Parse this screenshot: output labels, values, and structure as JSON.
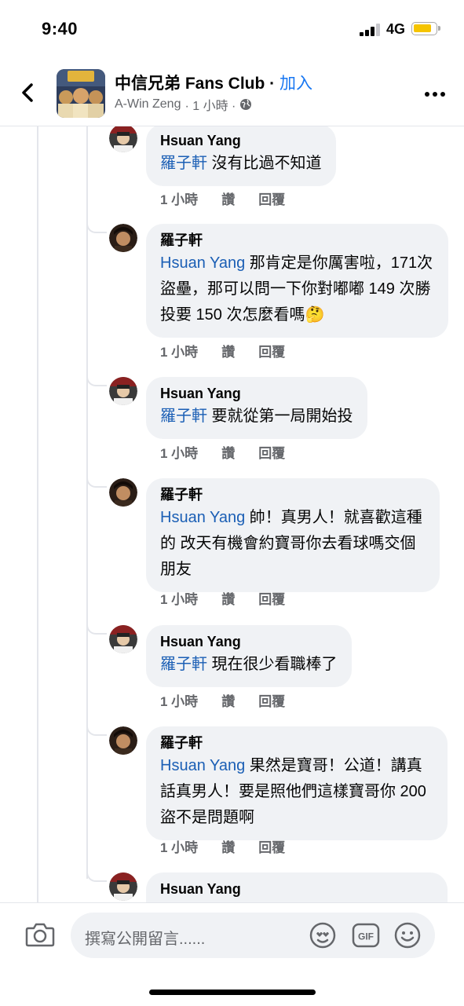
{
  "status_bar": {
    "time": "9:40",
    "network": "4G"
  },
  "header": {
    "group_name": "中信兄弟 Fans Club",
    "separator": " · ",
    "join_label": "加入",
    "post_author": "A-Win Zeng",
    "post_time": " · 1 小時 · "
  },
  "thread": {
    "comments": [
      {
        "author": "Hsuan Yang",
        "mention": "羅子軒",
        "text": " 沒有比過不知道",
        "time": "1 小時",
        "like": "讚",
        "reply": "回覆"
      },
      {
        "author": "羅子軒",
        "mention": "Hsuan Yang",
        "text": " 那肯定是你厲害啦，171次盜壘，那可以問一下你對嘟嘟 149 次勝投要 150 次怎麼看嗎🤔",
        "time": "1 小時",
        "like": "讚",
        "reply": "回覆"
      },
      {
        "author": "Hsuan Yang",
        "mention": "羅子軒",
        "text": " 要就從第一局開始投",
        "time": "1 小時",
        "like": "讚",
        "reply": "回覆"
      },
      {
        "author": "羅子軒",
        "mention": "Hsuan Yang",
        "text": " 帥！真男人！就喜歡這種的 改天有機會約寶哥你去看球嗎交個朋友",
        "time": "1 小時",
        "like": "讚",
        "reply": "回覆"
      },
      {
        "author": "Hsuan Yang",
        "mention": "羅子軒",
        "text": " 現在很少看職棒了",
        "time": "1 小時",
        "like": "讚",
        "reply": "回覆"
      },
      {
        "author": "羅子軒",
        "mention": "Hsuan Yang",
        "text": " 果然是寶哥！公道！講真話真男人！要是照他們這樣寶哥你 200 盜不是問題啊",
        "time": "1 小時",
        "like": "讚",
        "reply": "回覆"
      },
      {
        "author": "Hsuan Yang"
      }
    ]
  },
  "composer": {
    "placeholder": "撰寫公開留言......"
  },
  "colors": {
    "accent": "#1877f2",
    "mention": "#1b5fb5",
    "bubble": "#f0f2f5",
    "meta": "#65676b",
    "battery": "#f5c400"
  }
}
